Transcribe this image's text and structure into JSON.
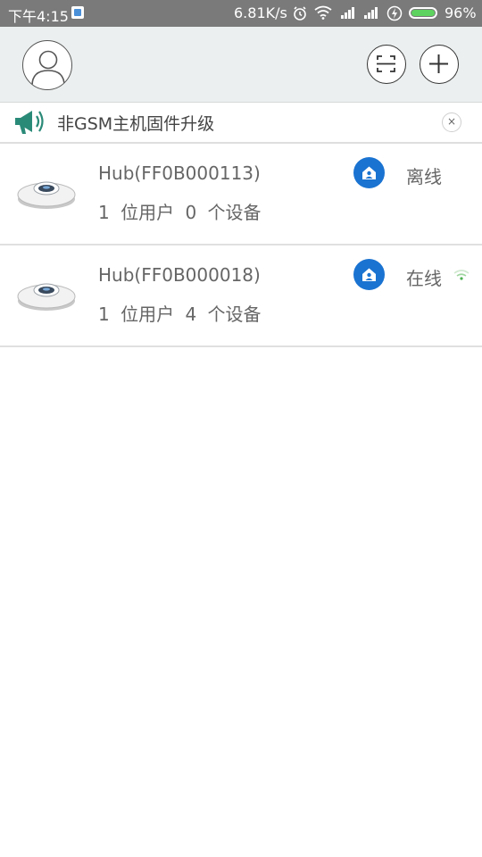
{
  "status_bar": {
    "time": "下午4:15",
    "speed": "6.81K/s",
    "battery_pct": "96%",
    "battery_level": 0.96,
    "icons": [
      "notification-icon",
      "alarm-icon",
      "wifi-icon",
      "signal-icon",
      "signal-icon",
      "charging-icon",
      "battery-icon"
    ]
  },
  "header": {
    "avatar_icon": "user-avatar-icon",
    "scan_icon": "scan-icon",
    "add_icon": "plus-icon"
  },
  "notice": {
    "icon": "megaphone-icon",
    "text": "非GSM主机固件升级",
    "close_label": "×",
    "accent": "#2a8a78"
  },
  "hubs": [
    {
      "name": "Hub(FF0B000113)",
      "info": "1 位用户 0 个设备",
      "status": "离线",
      "online": false
    },
    {
      "name": "Hub(FF0B000018)",
      "info": "1 位用户 4 个设备",
      "status": "在线",
      "online": true
    }
  ],
  "colors": {
    "home_badge": "#1a73d1",
    "online_signal": "#4caf50",
    "header_bg": "#ecefef"
  }
}
